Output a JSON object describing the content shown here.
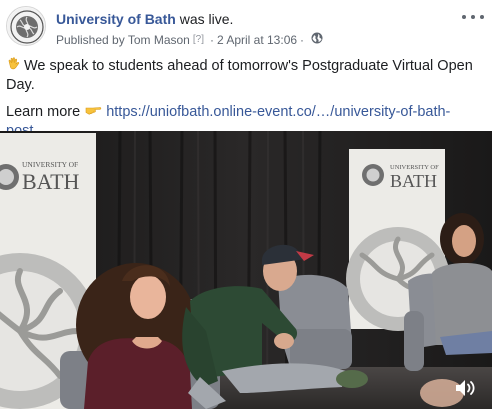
{
  "post": {
    "page_name": "University of Bath",
    "action": " was live.",
    "published_by": "Published by Tom Mason",
    "badge": "[?]",
    "date_sep": "·",
    "date": "2 April at 13:06",
    "privacy_sep": "·",
    "privacy_icon": "globe-icon",
    "menu_icon": "more-options-icon",
    "line1": "We speak to students ahead of tomorrow's Postgraduate Virtual Open Day.",
    "learn_more": "Learn more",
    "link": "https://uniofbath.online-event.co/…/university-of-bath-post…",
    "emoji_1": "waving-hand-icon",
    "emoji_2": "pointing-right-icon"
  },
  "video": {
    "banner_left": {
      "line1": "UNIVERSITY OF",
      "line2": "BATH"
    },
    "banner_right": {
      "line1": "UNIVERSITY OF",
      "line2": "BATH"
    },
    "volume_icon": "volume-icon"
  },
  "colors": {
    "link": "#385898",
    "meta": "#606770",
    "backdrop": "#1d1c1c",
    "chair": "#8a8d94"
  }
}
